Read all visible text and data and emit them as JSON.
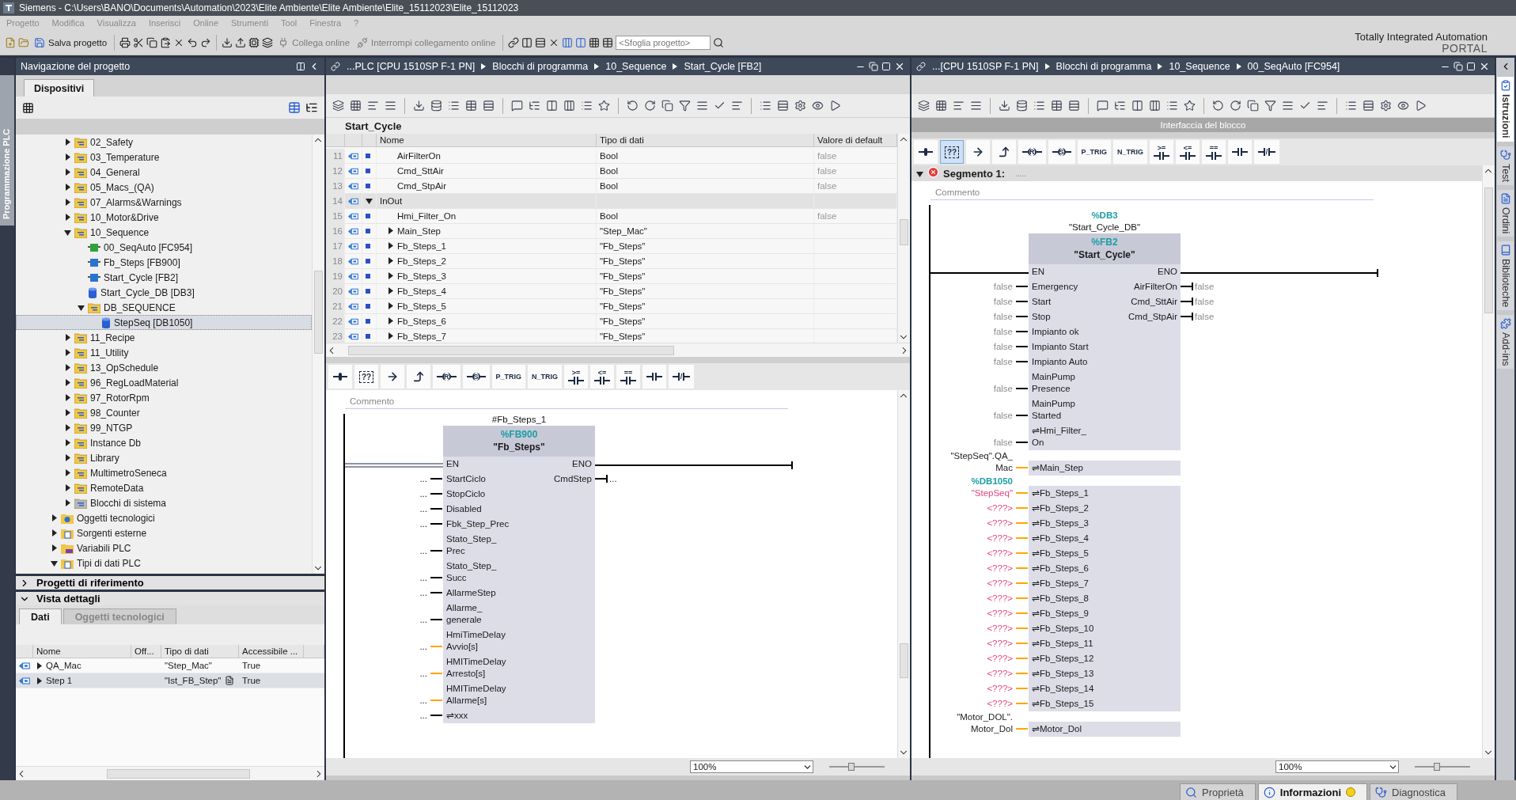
{
  "window": {
    "title": "Siemens  -  C:\\Users\\BANO\\Documents\\Automation\\2023\\Elite Ambiente\\Elite Ambiente\\Elite_15112023\\Elite_15112023"
  },
  "menu": [
    "Progetto",
    "Modifica",
    "Visualizza",
    "Inserisci",
    "Online",
    "Strumenti",
    "Tool",
    "Finestra",
    "?"
  ],
  "toolbar": {
    "save": "Salva progetto",
    "connect": "Collega online",
    "disconnect": "Interrompi collegamento online",
    "search_placeholder": "<Sfoglia progetto>"
  },
  "brand": {
    "line1": "Totally Integrated Automation",
    "line2": "PORTAL"
  },
  "side_tab_left": {
    "label": "Programmazione PLC"
  },
  "navigator": {
    "title": "Navigazione del progetto",
    "tabs": [
      {
        "label": "Dispositivi",
        "selected": true
      }
    ],
    "tree": [
      {
        "kind": "hidden",
        "children": [
          {
            "label": "02_Safety",
            "kind": "folder",
            "expanded": false,
            "selected": false
          },
          {
            "label": "03_Temperature",
            "kind": "folder",
            "expanded": false,
            "selected": false
          },
          {
            "label": "04_General",
            "kind": "folder",
            "expanded": false,
            "selected": false
          },
          {
            "label": "05_Macs_(QA)",
            "kind": "folder",
            "expanded": false,
            "selected": false
          },
          {
            "label": "07_Alarms&Warnings",
            "kind": "folder",
            "expanded": false,
            "selected": false
          },
          {
            "label": "10_Motor&Drive",
            "kind": "folder",
            "expanded": false,
            "selected": false
          },
          {
            "label": "10_Sequence",
            "kind": "folder",
            "expanded": true,
            "selected": false,
            "children": [
              {
                "label": "00_SeqAuto [FC954]",
                "kind": "fc",
                "selected": false
              },
              {
                "label": "Fb_Steps [FB900]",
                "kind": "fb",
                "selected": false
              },
              {
                "label": "Start_Cycle [FB2]",
                "kind": "fb",
                "selected": false
              },
              {
                "label": "Start_Cycle_DB [DB3]",
                "kind": "db",
                "selected": false
              },
              {
                "label": "DB_SEQUENCE",
                "kind": "folder",
                "expanded": true,
                "selected": false,
                "children": [
                  {
                    "label": "StepSeq [DB1050]",
                    "kind": "db",
                    "selected": true
                  }
                ]
              }
            ]
          },
          {
            "label": "11_Recipe",
            "kind": "folder",
            "expanded": false,
            "selected": false
          },
          {
            "label": "11_Utility",
            "kind": "folder",
            "expanded": false,
            "selected": false
          },
          {
            "label": "13_OpSchedule",
            "kind": "folder",
            "expanded": false,
            "selected": false
          },
          {
            "label": "96_RegLoadMaterial",
            "kind": "folder",
            "expanded": false,
            "selected": false
          },
          {
            "label": "97_RotorRpm",
            "kind": "folder",
            "expanded": false,
            "selected": false
          },
          {
            "label": "98_Counter",
            "kind": "folder",
            "expanded": false,
            "selected": false
          },
          {
            "label": "99_NTGP",
            "kind": "folder",
            "expanded": false,
            "selected": false
          },
          {
            "label": "Instance Db",
            "kind": "folder",
            "expanded": false,
            "selected": false
          },
          {
            "label": "Library",
            "kind": "folder",
            "expanded": false,
            "selected": false
          },
          {
            "label": "MultimetroSeneca",
            "kind": "folder",
            "expanded": false,
            "selected": false
          },
          {
            "label": "RemoteData",
            "kind": "folder",
            "expanded": false,
            "selected": false
          },
          {
            "label": "Blocchi di sistema",
            "kind": "sysfolder",
            "expanded": false,
            "selected": false
          }
        ]
      },
      {
        "label": "Oggetti tecnologici",
        "kind": "tech",
        "expanded": false,
        "selected": false
      },
      {
        "label": "Sorgenti esterne",
        "kind": "source",
        "expanded": false,
        "selected": false
      },
      {
        "label": "Variabili PLC",
        "kind": "tags",
        "expanded": false,
        "selected": false
      },
      {
        "label": "Tipi di dati PLC",
        "kind": "types",
        "expanded": true,
        "selected": false
      }
    ]
  },
  "reference_projects": {
    "title": "Progetti di riferimento",
    "expanded": false
  },
  "details": {
    "title": "Vista dettagli",
    "expanded": true,
    "tabs": [
      {
        "label": "Dati",
        "selected": true
      },
      {
        "label": "Oggetti tecnologici",
        "selected": false
      }
    ],
    "columns": [
      "Nome",
      "Off...",
      "Tipo di dati",
      "Accessibile ..."
    ],
    "rows": [
      {
        "name": "QA_Mac",
        "type": "\"Step_Mac\"",
        "accessible": "True",
        "selected": false
      },
      {
        "name": "Step 1",
        "type": "\"Ist_FB_Step\"",
        "accessible": "True",
        "selected": true
      }
    ]
  },
  "editor_left": {
    "breadcrumb": [
      "...PLC [CPU 1510SP F-1 PN]",
      "Blocchi di programma",
      "10_Sequence",
      "Start_Cycle [FB2]"
    ],
    "block_title": "Start_Cycle",
    "columns": [
      "Nome",
      "Tipo di dati",
      "Valore di default"
    ],
    "rows": [
      {
        "num": "11",
        "name": "AirFilterOn",
        "type": "Bool",
        "default": "false",
        "kind": "var"
      },
      {
        "num": "12",
        "name": "Cmd_SttAir",
        "type": "Bool",
        "default": "false",
        "kind": "var"
      },
      {
        "num": "13",
        "name": "Cmd_StpAir",
        "type": "Bool",
        "default": "false",
        "kind": "var"
      },
      {
        "num": "14",
        "name": "InOut",
        "kind": "section",
        "expanded": true
      },
      {
        "num": "15",
        "name": "Hmi_Filter_On",
        "type": "Bool",
        "default": "false",
        "kind": "var"
      },
      {
        "num": "16",
        "name": "Main_Step",
        "type": "\"Step_Mac\"",
        "kind": "struct",
        "expanded": false
      },
      {
        "num": "17",
        "name": "Fb_Steps_1",
        "type": "\"Fb_Steps\"",
        "kind": "struct",
        "expanded": false
      },
      {
        "num": "18",
        "name": "Fb_Steps_2",
        "type": "\"Fb_Steps\"",
        "kind": "struct",
        "expanded": false
      },
      {
        "num": "19",
        "name": "Fb_Steps_3",
        "type": "\"Fb_Steps\"",
        "kind": "struct",
        "expanded": false
      },
      {
        "num": "20",
        "name": "Fb_Steps_4",
        "type": "\"Fb_Steps\"",
        "kind": "struct",
        "expanded": false
      },
      {
        "num": "21",
        "name": "Fb_Steps_5",
        "type": "\"Fb_Steps\"",
        "kind": "struct",
        "expanded": false
      },
      {
        "num": "22",
        "name": "Fb_Steps_6",
        "type": "\"Fb_Steps\"",
        "kind": "struct",
        "expanded": false
      },
      {
        "num": "23",
        "name": "Fb_Steps_7",
        "type": "\"Fb_Steps\"",
        "kind": "struct",
        "expanded": false
      }
    ],
    "palette": [
      {
        "kind": "coil",
        "selected": false
      },
      {
        "kind": "box",
        "label": "??",
        "selected": false
      },
      {
        "kind": "jump",
        "selected": false
      },
      {
        "kind": "return",
        "selected": false
      },
      {
        "kind": "reset",
        "label": "R",
        "selected": false
      },
      {
        "kind": "set",
        "label": "S",
        "selected": false
      },
      {
        "kind": "ptrig",
        "label": "P_TRIG",
        "selected": false
      },
      {
        "kind": "ntrig",
        "label": "N_TRIG",
        "selected": false
      },
      {
        "kind": "compare",
        "label": ">=",
        "selected": false
      },
      {
        "kind": "compare",
        "label": "<=",
        "selected": false
      },
      {
        "kind": "compare",
        "label": "==",
        "selected": false
      },
      {
        "kind": "no",
        "selected": false
      },
      {
        "kind": "nc",
        "label": "/",
        "selected": false
      }
    ],
    "comment_placeholder": "Commento",
    "network": {
      "instance": "#Fb_Steps_1",
      "address": "%FB900",
      "name": "\"Fb_Steps\"",
      "en": "EN",
      "eno": "ENO",
      "en_connected": false,
      "pins": [
        {
          "name": "StartCiclo",
          "actual": "...",
          "kind": "dots",
          "color": "#000000",
          "out": "CmdStep",
          "out_actual": "..."
        },
        {
          "name": "StopCiclo",
          "actual": "...",
          "kind": "dots",
          "color": "#000000"
        },
        {
          "name": "Disabled",
          "actual": "...",
          "kind": "dots",
          "color": "#000000"
        },
        {
          "name": "Fbk_Step_Prec",
          "actual": "...",
          "kind": "dots",
          "color": "#000000"
        },
        {
          "name": "Stato_Step_\nPrec",
          "actual": "...",
          "kind": "dots",
          "color": "#000000"
        },
        {
          "name": "Stato_Step_\nSucc",
          "actual": "...",
          "kind": "dots",
          "color": "#000000"
        },
        {
          "name": "AllarmeStep",
          "actual": "...",
          "kind": "dots",
          "color": "#000000"
        },
        {
          "name": "Allarme_\ngenerale",
          "actual": "...",
          "kind": "dots",
          "color": "#000000"
        },
        {
          "name": "HmiTimeDelay\nAvvio[s]",
          "actual": "...",
          "kind": "dots",
          "color": "#ffa500"
        },
        {
          "name": "HMITimeDelay\nArresto[s]",
          "actual": "...",
          "kind": "dots",
          "color": "#ffa500"
        },
        {
          "name": "HMITimeDelay\nAllarme[s]",
          "actual": "...",
          "kind": "dots",
          "color": "#ffa500"
        },
        {
          "name": "⇌xxx",
          "actual": "...",
          "kind": "dots",
          "color": "#000000"
        }
      ]
    },
    "zoom": "100%",
    "zoom_slider": {
      "level": 0.4
    }
  },
  "editor_right": {
    "breadcrumb": [
      "...[CPU 1510SP F-1 PN]",
      "Blocchi di programma",
      "10_Sequence",
      "00_SeqAuto [FC954]"
    ],
    "interface_label": "Interfaccia del blocco",
    "palette": [
      {
        "kind": "coil",
        "selected": false
      },
      {
        "kind": "box",
        "label": "??",
        "selected": true
      },
      {
        "kind": "jump",
        "selected": false
      },
      {
        "kind": "return",
        "selected": false
      },
      {
        "kind": "reset",
        "label": "R",
        "selected": false
      },
      {
        "kind": "set",
        "label": "S",
        "selected": false
      },
      {
        "kind": "ptrig",
        "label": "P_TRIG",
        "selected": false
      },
      {
        "kind": "ntrig",
        "label": "N_TRIG",
        "selected": false
      },
      {
        "kind": "compare",
        "label": ">=",
        "selected": false
      },
      {
        "kind": "compare",
        "label": "<=",
        "selected": false
      },
      {
        "kind": "compare",
        "label": "==",
        "selected": false
      },
      {
        "kind": "no",
        "selected": false
      },
      {
        "kind": "nc",
        "label": "/",
        "selected": false
      }
    ],
    "segment": {
      "title": "Segmento 1:",
      "hint": ".....",
      "expanded": true,
      "error": true
    },
    "comment_placeholder": "Commento",
    "network": {
      "db_address": "%DB3",
      "db_name": "\"Start_Cycle_DB\"",
      "address": "%FB2",
      "name": "\"Start_Cycle\"",
      "en": "EN",
      "eno": "ENO",
      "en_connected": true,
      "pins": [
        {
          "name": "Emergency",
          "actual": "false",
          "kind": "default",
          "color": "#000000",
          "out": "AirFilterOn",
          "out_actual": "false"
        },
        {
          "name": "Start",
          "actual": "false",
          "kind": "default",
          "color": "#000000",
          "out": "Cmd_SttAir",
          "out_actual": "false"
        },
        {
          "name": "Stop",
          "actual": "false",
          "kind": "default",
          "color": "#000000",
          "out": "Cmd_StpAir",
          "out_actual": "false"
        },
        {
          "name": "Impianto ok",
          "actual": "false",
          "kind": "default",
          "color": "#000000"
        },
        {
          "name": "Impianto Start",
          "actual": "false",
          "kind": "default",
          "color": "#000000"
        },
        {
          "name": "Impianto Auto",
          "actual": "false",
          "kind": "default",
          "color": "#000000"
        },
        {
          "name": "MainPump\nPresence",
          "actual": "false",
          "kind": "default",
          "color": "#000000"
        },
        {
          "name": "MainPump\nStarted",
          "actual": "false",
          "kind": "default",
          "color": "#000000"
        },
        {
          "name": "⇌Hmi_Filter_\nOn",
          "actual": "false",
          "kind": "default",
          "color": "#000000"
        },
        {
          "name": "⇌Main_Step",
          "actual": "\"StepSeq\".QA_\nMac",
          "kind": "tag",
          "color": "#ffa500"
        },
        {
          "name": "⇌Fb_Steps_1",
          "actual_address": "%DB1050",
          "actual": "\"StepSeq\"",
          "kind": "error",
          "color": "#ffa500"
        },
        {
          "name": "⇌Fb_Steps_2",
          "actual": "<???>",
          "kind": "error",
          "color": "#ffa500"
        },
        {
          "name": "⇌Fb_Steps_3",
          "actual": "<???>",
          "kind": "error",
          "color": "#ffa500"
        },
        {
          "name": "⇌Fb_Steps_4",
          "actual": "<???>",
          "kind": "error",
          "color": "#ffa500"
        },
        {
          "name": "⇌Fb_Steps_5",
          "actual": "<???>",
          "kind": "error",
          "color": "#ffa500"
        },
        {
          "name": "⇌Fb_Steps_6",
          "actual": "<???>",
          "kind": "error",
          "color": "#ffa500"
        },
        {
          "name": "⇌Fb_Steps_7",
          "actual": "<???>",
          "kind": "error",
          "color": "#ffa500"
        },
        {
          "name": "⇌Fb_Steps_8",
          "actual": "<???>",
          "kind": "error",
          "color": "#ffa500"
        },
        {
          "name": "⇌Fb_Steps_9",
          "actual": "<???>",
          "kind": "error",
          "color": "#ffa500"
        },
        {
          "name": "⇌Fb_Steps_10",
          "actual": "<???>",
          "kind": "error",
          "color": "#ffa500"
        },
        {
          "name": "⇌Fb_Steps_11",
          "actual": "<???>",
          "kind": "error",
          "color": "#ffa500"
        },
        {
          "name": "⇌Fb_Steps_12",
          "actual": "<???>",
          "kind": "error",
          "color": "#ffa500"
        },
        {
          "name": "⇌Fb_Steps_13",
          "actual": "<???>",
          "kind": "error",
          "color": "#ffa500"
        },
        {
          "name": "⇌Fb_Steps_14",
          "actual": "<???>",
          "kind": "error",
          "color": "#ffa500"
        },
        {
          "name": "⇌Fb_Steps_15",
          "actual": "<???>",
          "kind": "error",
          "color": "#ffa500"
        },
        {
          "name": "⇌Motor_Dol",
          "actual": "\"Motor_DOL\".\nMotor_Dol",
          "kind": "tag",
          "color": "#ffa500"
        }
      ]
    },
    "zoom": "100%",
    "zoom_slider": {
      "level": 0.4
    }
  },
  "task_tabs": [
    {
      "label": "Istruzioni",
      "selected": true
    },
    {
      "label": "Test",
      "selected": false
    },
    {
      "label": "Ordini",
      "selected": false
    },
    {
      "label": "Biblioteche",
      "selected": false
    },
    {
      "label": "Add-ins",
      "selected": false
    }
  ],
  "status_tabs": [
    {
      "label": "Proprietà",
      "kind": "properties",
      "selected": false
    },
    {
      "label": "Informazioni",
      "kind": "info",
      "selected": true
    },
    {
      "label": "Diagnostica",
      "kind": "diagnostics",
      "selected": false
    }
  ]
}
